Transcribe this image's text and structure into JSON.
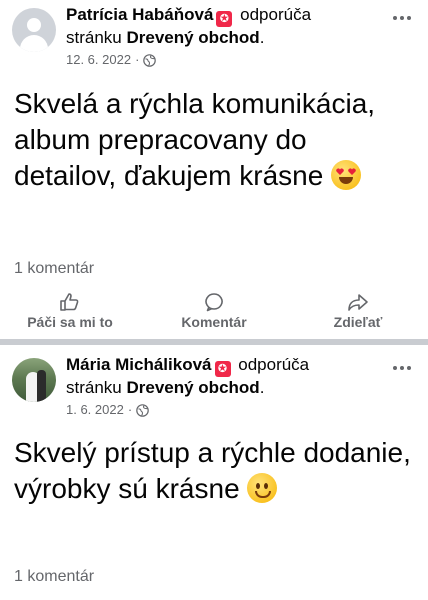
{
  "posts": [
    {
      "author": "Patrícia Habáňová",
      "badge_glyph": "✪",
      "action_text": "odporúča",
      "page_prefix": "stránku",
      "page_name": "Drevený obchod",
      "page_suffix": ".",
      "date": "12. 6. 2022",
      "separator": "·",
      "privacy_icon": "globe-icon",
      "body_text": "Skvelá a rýchla komunikácia, album prepracovany do detailov, ďakujem krásne",
      "emoji": "heart-eyes-emoji",
      "comments": "1 komentár",
      "avatar": "default-avatar"
    },
    {
      "author": "Mária Micháliková",
      "badge_glyph": "✪",
      "action_text": "odporúča",
      "page_prefix": "stránku",
      "page_name": "Drevený obchod",
      "page_suffix": ".",
      "date": "1. 6. 2022",
      "separator": "·",
      "privacy_icon": "globe-icon",
      "body_text": "Skvelý prístup a rýchle dodanie, výrobky sú krásne",
      "emoji": "smiling-emoji",
      "comments": "1 komentár",
      "avatar": "wedding-photo-avatar"
    }
  ],
  "actions": {
    "like": "Páči sa mi to",
    "comment": "Komentár",
    "share": "Zdieľať"
  },
  "colors": {
    "text": "#050505",
    "secondary": "#65676b",
    "badge": "#f02849",
    "divider": "#c9ccd1"
  }
}
